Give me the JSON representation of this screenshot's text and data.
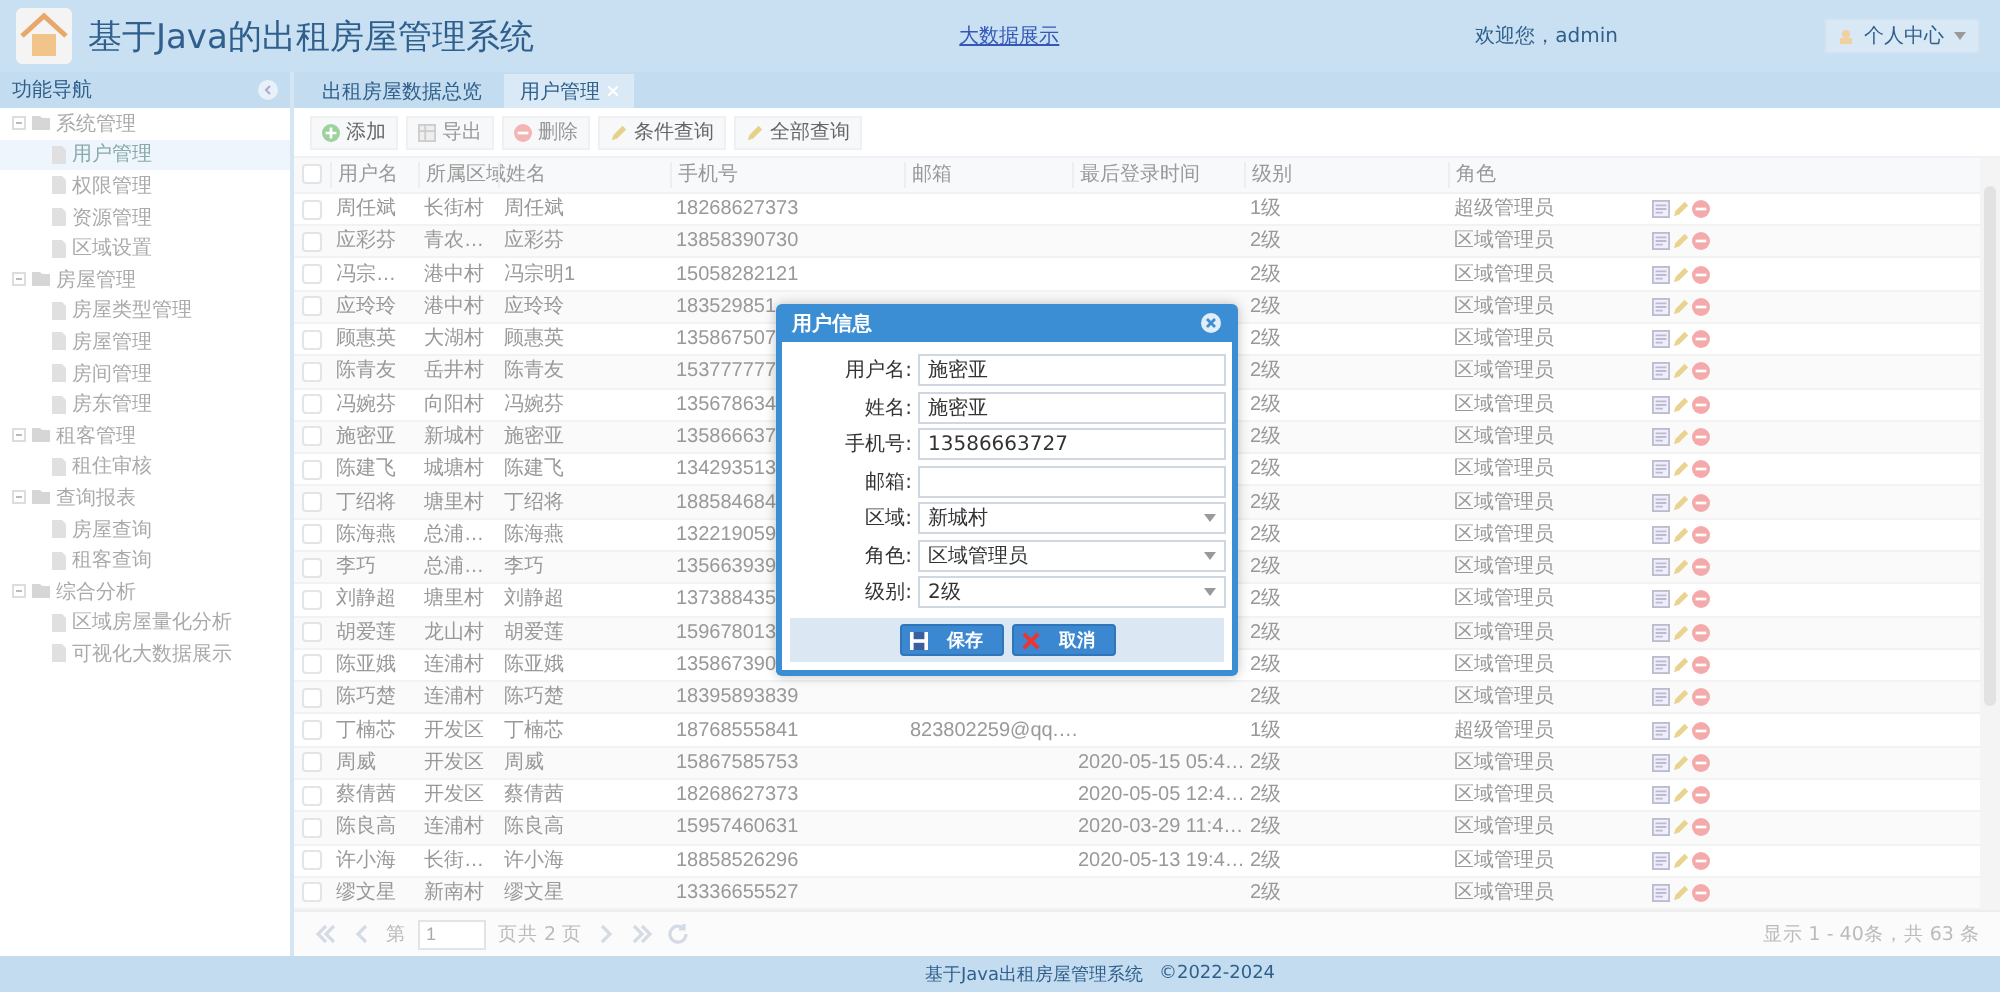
{
  "header": {
    "title": "基于Java的出租房屋管理系统",
    "big_data_link": "大数据展示",
    "welcome": "欢迎您，admin",
    "user_menu": "个人中心"
  },
  "nav": {
    "title": "功能导航",
    "tree": [
      {
        "label": "系统管理",
        "expanded": true,
        "children": [
          {
            "label": "用户管理",
            "selected": true
          },
          {
            "label": "权限管理",
            "selected": false
          },
          {
            "label": "资源管理",
            "selected": false
          },
          {
            "label": "区域设置",
            "selected": false
          }
        ]
      },
      {
        "label": "房屋管理",
        "expanded": true,
        "children": [
          {
            "label": "房屋类型管理",
            "selected": false
          },
          {
            "label": "房屋管理",
            "selected": false
          },
          {
            "label": "房间管理",
            "selected": false
          },
          {
            "label": "房东管理",
            "selected": false
          }
        ]
      },
      {
        "label": "租客管理",
        "expanded": true,
        "children": [
          {
            "label": "租住审核",
            "selected": false
          }
        ]
      },
      {
        "label": "查询报表",
        "expanded": true,
        "children": [
          {
            "label": "房屋查询",
            "selected": false
          },
          {
            "label": "租客查询",
            "selected": false
          }
        ]
      },
      {
        "label": "综合分析",
        "expanded": true,
        "children": [
          {
            "label": "区域房屋量化分析",
            "selected": false
          },
          {
            "label": "可视化大数据展示",
            "selected": false
          }
        ]
      }
    ]
  },
  "tabs": [
    {
      "label": "出租房屋数据总览",
      "selected": false,
      "closable": false
    },
    {
      "label": "用户管理",
      "selected": true,
      "closable": true
    }
  ],
  "toolbar": [
    {
      "label": "添加",
      "kind": "add",
      "disabled": false
    },
    {
      "label": "导出",
      "kind": "export",
      "disabled": true
    },
    {
      "label": "删除",
      "kind": "delete",
      "disabled": true
    },
    {
      "label": "条件查询",
      "kind": "search",
      "disabled": false
    },
    {
      "label": "全部查询",
      "kind": "search",
      "disabled": false
    }
  ],
  "table": {
    "select_all_checked": false,
    "columns": [
      "用户名",
      "所属区域",
      "姓名",
      "手机号",
      "邮箱",
      "最后登录时间",
      "级别",
      "角色"
    ],
    "rows": [
      {
        "checked": false,
        "cells": [
          "周任斌",
          "长街村",
          "周任斌",
          "18268627373",
          "",
          "",
          "1级",
          "超级管理员"
        ]
      },
      {
        "checked": false,
        "cells": [
          "应彩芬",
          "青农…",
          "应彩芬",
          "13858390730",
          "",
          "",
          "2级",
          "区域管理员"
        ]
      },
      {
        "checked": false,
        "cells": [
          "冯宗…",
          "港中村",
          "冯宗明1",
          "15058282121",
          "",
          "",
          "2级",
          "区域管理员"
        ]
      },
      {
        "checked": false,
        "cells": [
          "应玲玲",
          "港中村",
          "应玲玲",
          "183529851",
          "",
          "",
          "2级",
          "区域管理员"
        ]
      },
      {
        "checked": false,
        "cells": [
          "顾惠英",
          "大湖村",
          "顾惠英",
          "135867507",
          "",
          "",
          "2级",
          "区域管理员"
        ]
      },
      {
        "checked": false,
        "cells": [
          "陈青友",
          "岳井村",
          "陈青友",
          "153777777",
          "",
          "",
          "2级",
          "区域管理员"
        ]
      },
      {
        "checked": false,
        "cells": [
          "冯婉芬",
          "向阳村",
          "冯婉芬",
          "135678634",
          "",
          "",
          "2级",
          "区域管理员"
        ]
      },
      {
        "checked": false,
        "cells": [
          "施密亚",
          "新城村",
          "施密亚",
          "135866637",
          "",
          "",
          "2级",
          "区域管理员"
        ]
      },
      {
        "checked": false,
        "cells": [
          "陈建飞",
          "城塘村",
          "陈建飞",
          "134293513",
          "",
          "",
          "2级",
          "区域管理员"
        ]
      },
      {
        "checked": false,
        "cells": [
          "丁绍将",
          "塘里村",
          "丁绍将",
          "188584684",
          "",
          "",
          "2级",
          "区域管理员"
        ]
      },
      {
        "checked": false,
        "cells": [
          "陈海燕",
          "总浦…",
          "陈海燕",
          "132219059",
          "",
          "",
          "2级",
          "区域管理员"
        ]
      },
      {
        "checked": false,
        "cells": [
          "李巧",
          "总浦…",
          "李巧",
          "135663939",
          "",
          "",
          "2级",
          "区域管理员"
        ]
      },
      {
        "checked": false,
        "cells": [
          "刘静超",
          "塘里村",
          "刘静超",
          "137388435",
          "",
          "",
          "2级",
          "区域管理员"
        ]
      },
      {
        "checked": false,
        "cells": [
          "胡爱莲",
          "龙山村",
          "胡爱莲",
          "159678013",
          "",
          "",
          "2级",
          "区域管理员"
        ]
      },
      {
        "checked": false,
        "cells": [
          "陈亚娥",
          "连浦村",
          "陈亚娥",
          "135867390",
          "",
          "",
          "2级",
          "区域管理员"
        ]
      },
      {
        "checked": false,
        "cells": [
          "陈巧楚",
          "连浦村",
          "陈巧楚",
          "18395893839",
          "",
          "",
          "2级",
          "区域管理员"
        ]
      },
      {
        "checked": false,
        "cells": [
          "丁楠芯",
          "开发区",
          "丁楠芯",
          "18768555841",
          "823802259@qq.…",
          "",
          "1级",
          "超级管理员"
        ]
      },
      {
        "checked": false,
        "cells": [
          "周威",
          "开发区",
          "周威",
          "15867585753",
          "",
          "2020-05-15 05:4…",
          "2级",
          "区域管理员"
        ]
      },
      {
        "checked": false,
        "cells": [
          "蔡倩茜",
          "开发区",
          "蔡倩茜",
          "18268627373",
          "",
          "2020-05-05 12:4…",
          "2级",
          "区域管理员"
        ]
      },
      {
        "checked": false,
        "cells": [
          "陈良高",
          "连浦村",
          "陈良高",
          "15957460631",
          "",
          "2020-03-29 11:4…",
          "2级",
          "区域管理员"
        ]
      },
      {
        "checked": false,
        "cells": [
          "许小海",
          "长街…",
          "许小海",
          "18858526296",
          "",
          "2020-05-13 19:4…",
          "2级",
          "区域管理员"
        ]
      },
      {
        "checked": false,
        "cells": [
          "缪文星",
          "新南村",
          "缪文星",
          "13336655527",
          "",
          "",
          "2级",
          "区域管理员"
        ]
      }
    ]
  },
  "pager": {
    "page_prefix": "第",
    "page": "1",
    "page_suffix": "页共 2 页",
    "summary": "显示 1 - 40条，共 63 条"
  },
  "footer": {
    "system": "基于Java出租房屋管理系统",
    "copyright": "©2022-2024"
  },
  "dialog": {
    "title": "用户信息",
    "fields": [
      {
        "label": "用户名:",
        "value": "施密亚",
        "kind": "text"
      },
      {
        "label": "姓名:",
        "value": "施密亚",
        "kind": "text"
      },
      {
        "label": "手机号:",
        "value": "13586663727",
        "kind": "text"
      },
      {
        "label": "邮箱:",
        "kind": "text"
      },
      {
        "label": "区域:",
        "value": "新城村",
        "kind": "select"
      },
      {
        "label": "角色:",
        "value": "区域管理员",
        "kind": "select"
      },
      {
        "label": "级别:",
        "value": "2级",
        "kind": "select"
      }
    ],
    "buttons": [
      {
        "label": "保存",
        "kind": "save"
      },
      {
        "label": "取消",
        "kind": "cancel"
      }
    ]
  }
}
